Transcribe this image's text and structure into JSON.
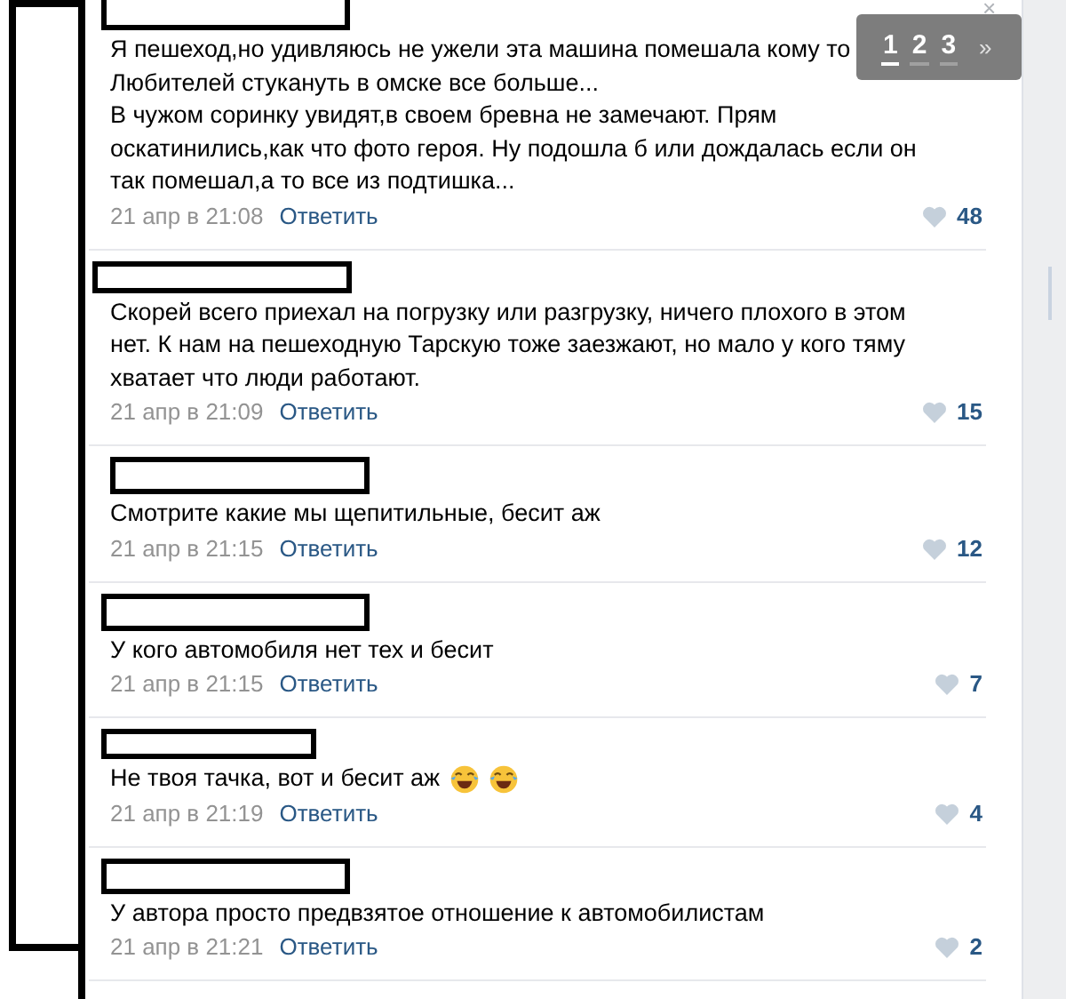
{
  "comments": [
    {
      "kind": "plain",
      "lines": [
        "Я пешеход,но удивляюсь не ужели эта машина помешала кому то",
        "Любителей стукануть в омске все больше...",
        "В чужом соринку увидят,в своем бревна не замечают. Прям",
        "оскатинились,как что фото героя. Ну подошла б или дождалась если он",
        "так помешал,а то все из подтишка..."
      ],
      "time": "21 апр в 21:08",
      "reply": "Ответить",
      "likes": "48"
    },
    {
      "kind": "plain",
      "lines": [
        "Скорей всего приехал на погрузку или разгрузку, ничего плохого в этом",
        "нет. К нам на пешеходную Тарскую тоже заезжают, но мало у кого тяму",
        "хватает что люди работают."
      ],
      "time": "21 апр в 21:09",
      "reply": "Ответить",
      "likes": "15"
    },
    {
      "kind": "plain",
      "lines": [
        "Смотрите какие мы щепитильные, бесит аж"
      ],
      "time": "21 апр в 21:15",
      "reply": "Ответить",
      "likes": "12"
    },
    {
      "kind": "plain",
      "lines": [
        "У кого автомобиля нет тех и бесит"
      ],
      "time": "21 апр в 21:15",
      "reply": "Ответить",
      "likes": "7"
    },
    {
      "kind": "with-emoji",
      "lines": [
        "Не твоя тачка, вот и бесит аж"
      ],
      "time": "21 апр в 21:19",
      "reply": "Ответить",
      "likes": "4"
    },
    {
      "kind": "plain",
      "lines": [
        "У автора просто предвзятое отношение к автомобилистам"
      ],
      "time": "21 апр в 21:21",
      "reply": "Ответить",
      "likes": "2"
    }
  ],
  "pager": {
    "pages": [
      {
        "label": "1",
        "selected": true
      },
      {
        "label": "2",
        "selected": false
      },
      {
        "label": "3",
        "selected": false
      }
    ],
    "next": "»",
    "close": "×"
  }
}
